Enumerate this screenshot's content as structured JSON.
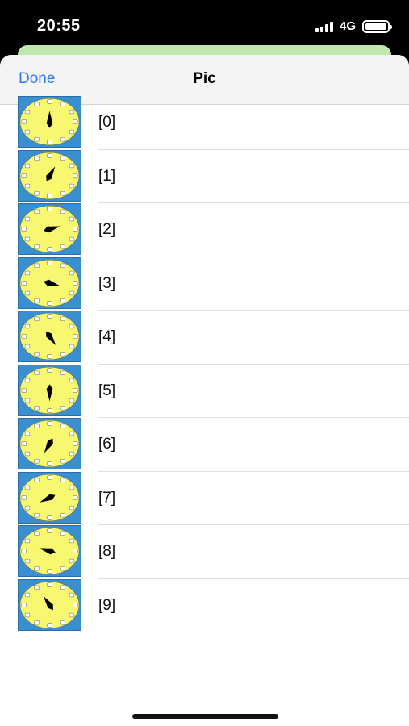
{
  "status_bar": {
    "time": "20:55",
    "network": "4G"
  },
  "nav": {
    "done_label": "Done",
    "title": "Pic"
  },
  "clock_colors": {
    "face": "#f8f870",
    "background": "#3a8fd0",
    "hand": "#000000"
  },
  "rows": [
    {
      "label": "[0]",
      "hand_angle": 0
    },
    {
      "label": "[1]",
      "hand_angle": 30
    },
    {
      "label": "[2]",
      "hand_angle": 75
    },
    {
      "label": "[3]",
      "hand_angle": 105
    },
    {
      "label": "[4]",
      "hand_angle": 145
    },
    {
      "label": "[5]",
      "hand_angle": 180
    },
    {
      "label": "[6]",
      "hand_angle": 210
    },
    {
      "label": "[7]",
      "hand_angle": 245
    },
    {
      "label": "[8]",
      "hand_angle": 285
    },
    {
      "label": "[9]",
      "hand_angle": 325
    }
  ]
}
